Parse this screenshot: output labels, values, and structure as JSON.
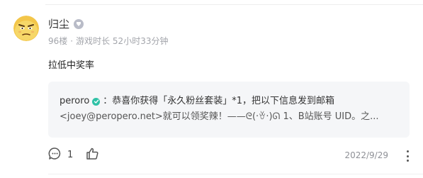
{
  "comment": {
    "author": {
      "name": "归尘",
      "level_badge": "",
      "floor": "96楼",
      "separator": "·",
      "playtime": "游戏时长 52小时33分钟"
    },
    "text": "拉低中奖率",
    "quote": {
      "author": "peroro",
      "line1": "：恭喜你获得「永久粉丝套装」*1，把以下信息发到邮箱",
      "line2": "<joey@peropero.net>就可以领奖辣！——ᘓ(·ꈊ·)ᘏ 1、B站账号 UID。之..."
    },
    "actions": {
      "comment_count": "1"
    },
    "date": "2022/9/29"
  },
  "colors": {
    "verified": "#2fc1a6",
    "card_bg": "#f5f6f8",
    "meta_text": "#a3a5ab"
  },
  "icons": [
    "avatar",
    "level-badge-icon",
    "verified-icon",
    "comment-icon",
    "like-icon",
    "more-icon"
  ]
}
